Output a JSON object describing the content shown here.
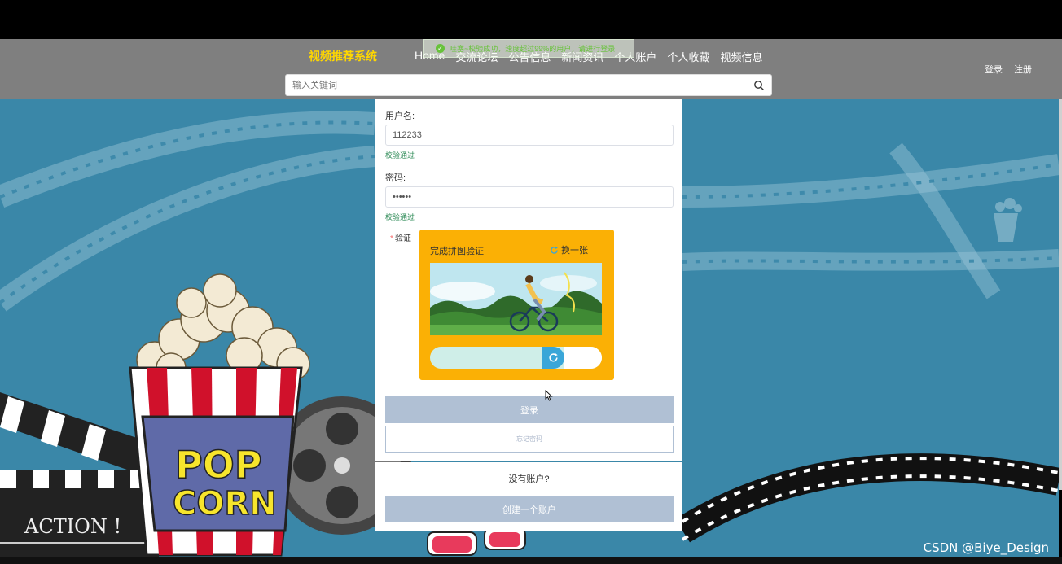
{
  "toast": {
    "message": "哇塞~校验成功，速度超过99%的用户，请进行登录"
  },
  "header": {
    "brand": "视频推荐系统",
    "nav": [
      "Home",
      "交流论坛",
      "公告信息",
      "新闻资讯",
      "个人账户",
      "个人收藏",
      "视频信息"
    ],
    "login_link": "登录",
    "register_link": "注册",
    "search_placeholder": "输入关键词"
  },
  "form": {
    "username_label": "用户名:",
    "username_value": "112233",
    "username_hint": "校验通过",
    "password_label": "密码:",
    "password_value": "••••••",
    "password_hint": "校验通过",
    "verify_required": "*",
    "verify_label": "验证",
    "captcha_title": "完成拼图验证",
    "captcha_refresh": "换一张",
    "captcha_progress": 0.75,
    "login_button": "登录",
    "forgot_button": "忘记密码",
    "no_account": "没有账户?",
    "create_button": "创建一个账户"
  },
  "background_text": {
    "popcorn_top": "POP",
    "popcorn_bottom": "CORN",
    "clapper": "ACTION !"
  },
  "watermark": "CSDN @Biye_Design",
  "colors": {
    "navbar": "#7f7f7f",
    "brand": "#ffd700",
    "scene": "#3a87a8",
    "captcha_panel": "#fbb005",
    "button": "#b0c0d4",
    "success": "#67c23a"
  }
}
